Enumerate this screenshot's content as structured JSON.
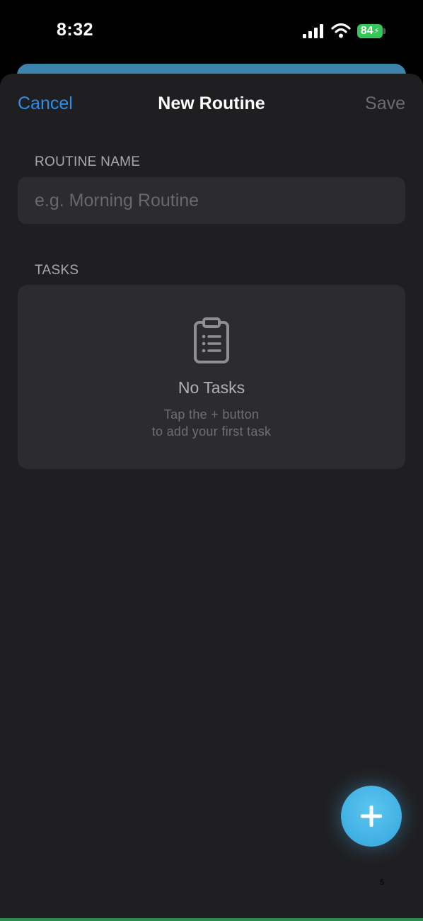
{
  "status_bar": {
    "time": "8:32",
    "battery_level": "84",
    "battery_color": "#35c759",
    "icons": [
      "signal-icon",
      "wifi-icon",
      "battery-icon",
      "charging-bolt-icon"
    ]
  },
  "nav": {
    "cancel_label": "Cancel",
    "title": "New Routine",
    "save_label": "Save"
  },
  "routine_name": {
    "label": "ROUTINE NAME",
    "placeholder": "e.g. Morning Routine",
    "value": ""
  },
  "tasks": {
    "label": "TASKS",
    "empty_icon": "clipboard-list-icon",
    "empty_title": "No Tasks",
    "empty_line1": "Tap the + button",
    "empty_line2": "to add your first task"
  },
  "fab": {
    "icon": "plus-icon"
  },
  "page_marker": "5",
  "colors": {
    "accent": "#2f8fe8",
    "fab": "#3fafe3",
    "sheet_background": "#1f1f21",
    "card_background": "#2c2c2e"
  }
}
